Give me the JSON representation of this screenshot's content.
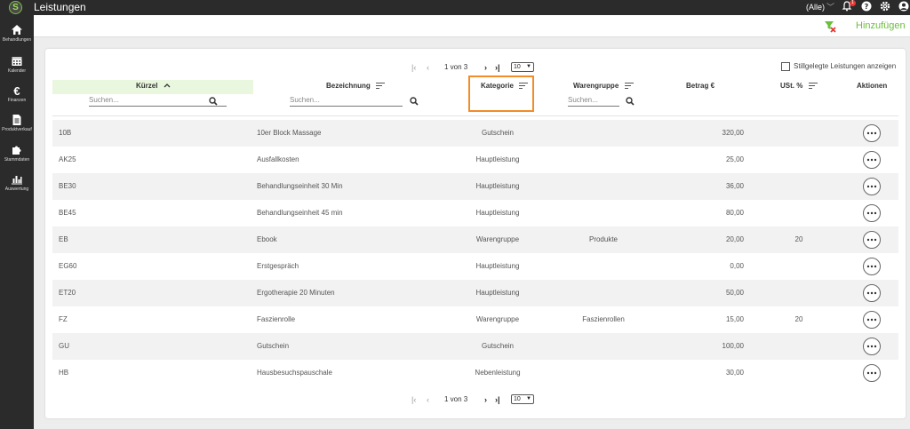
{
  "app": {
    "title": "Leistungen",
    "logo": "S",
    "scope_select": "(Alle)",
    "bell_count": "1"
  },
  "sidebar": {
    "items": [
      {
        "label": "Behandlungen",
        "icon": "home-icon"
      },
      {
        "label": "Kalender",
        "icon": "calendar-icon"
      },
      {
        "label": "Finanzen",
        "icon": "euro-icon"
      },
      {
        "label": "Produktverkauf",
        "icon": "document-icon"
      },
      {
        "label": "Stammdaten",
        "icon": "puzzle-icon"
      },
      {
        "label": "Auswertung",
        "icon": "bar-chart-icon"
      }
    ]
  },
  "toolbar": {
    "add_label": "Hinzufügen"
  },
  "pager": {
    "text": "1 von 3",
    "page_size": "10"
  },
  "filters": {
    "show_inactive_label": "Stillgelegte Leistungen anzeigen",
    "search_placeholder": "Suchen..."
  },
  "columns": {
    "kuerzel": "Kürzel",
    "bezeichnung": "Bezeichnung",
    "kategorie": "Kategorie",
    "warengruppe": "Warengruppe",
    "betrag": "Betrag €",
    "ust": "USt. %",
    "aktionen": "Aktionen"
  },
  "rows": [
    {
      "kuerzel": "10B",
      "bezeichnung": "10er Block Massage",
      "kategorie": "Gutschein",
      "warengruppe": "",
      "betrag": "320,00",
      "ust": ""
    },
    {
      "kuerzel": "AK25",
      "bezeichnung": "Ausfallkosten",
      "kategorie": "Hauptleistung",
      "warengruppe": "",
      "betrag": "25,00",
      "ust": ""
    },
    {
      "kuerzel": "BE30",
      "bezeichnung": "Behandlungseinheit 30 Min",
      "kategorie": "Hauptleistung",
      "warengruppe": "",
      "betrag": "36,00",
      "ust": ""
    },
    {
      "kuerzel": "BE45",
      "bezeichnung": "Behandlungseinheit 45 min",
      "kategorie": "Hauptleistung",
      "warengruppe": "",
      "betrag": "80,00",
      "ust": ""
    },
    {
      "kuerzel": "EB",
      "bezeichnung": "Ebook",
      "kategorie": "Warengruppe",
      "warengruppe": "Produkte",
      "betrag": "20,00",
      "ust": "20"
    },
    {
      "kuerzel": "EG60",
      "bezeichnung": "Erstgespräch",
      "kategorie": "Hauptleistung",
      "warengruppe": "",
      "betrag": "0,00",
      "ust": ""
    },
    {
      "kuerzel": "ET20",
      "bezeichnung": "Ergotherapie 20 Minuten",
      "kategorie": "Hauptleistung",
      "warengruppe": "",
      "betrag": "50,00",
      "ust": ""
    },
    {
      "kuerzel": "FZ",
      "bezeichnung": "Faszienrolle",
      "kategorie": "Warengruppe",
      "warengruppe": "Faszienrollen",
      "betrag": "15,00",
      "ust": "20"
    },
    {
      "kuerzel": "GU",
      "bezeichnung": "Gutschein",
      "kategorie": "Gutschein",
      "warengruppe": "",
      "betrag": "100,00",
      "ust": ""
    },
    {
      "kuerzel": "HB",
      "bezeichnung": "Hausbesuchspauschale",
      "kategorie": "Nebenleistung",
      "warengruppe": "",
      "betrag": "30,00",
      "ust": ""
    }
  ],
  "colors": {
    "accent_green": "#6abf3b",
    "highlight_orange": "#f28c28",
    "topbar": "#2b2b2b"
  }
}
